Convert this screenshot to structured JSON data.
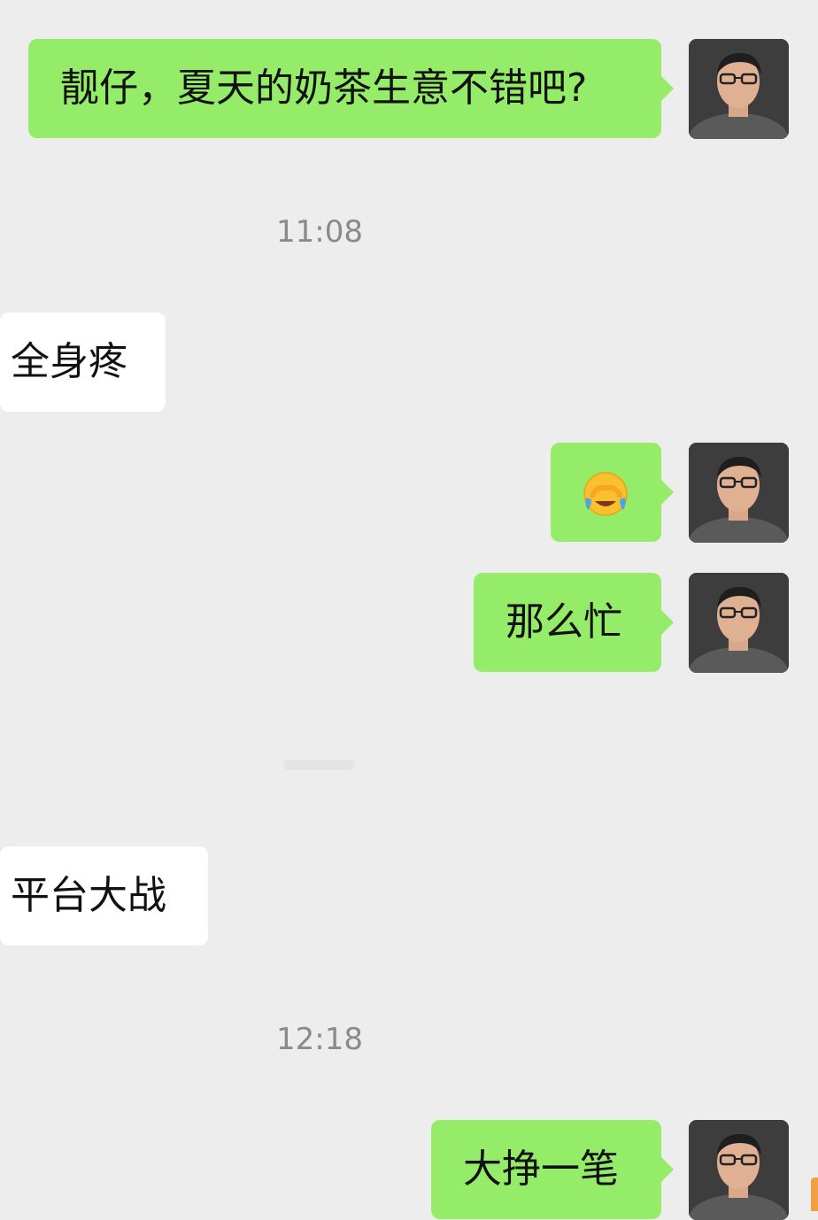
{
  "messages": [
    {
      "id": "m1",
      "side": "sent",
      "text": "靓仔，夏天的奶茶生意不错吧?"
    },
    {
      "id": "t1",
      "type": "timestamp",
      "text": "11:08"
    },
    {
      "id": "m2",
      "side": "received",
      "text": "全身疼"
    },
    {
      "id": "m3",
      "side": "sent",
      "emoji": "face-palm-crying-emoji"
    },
    {
      "id": "m4",
      "side": "sent",
      "text": "那么忙"
    },
    {
      "id": "m5",
      "side": "received",
      "text": "平台大战"
    },
    {
      "id": "t2",
      "type": "timestamp",
      "text": "12:18"
    },
    {
      "id": "m6",
      "side": "sent",
      "text": "大挣一笔"
    }
  ],
  "colors": {
    "background": "#ededed",
    "sent_bubble": "#95ec69",
    "received_bubble": "#ffffff",
    "timestamp_text": "#8a8a8a"
  }
}
